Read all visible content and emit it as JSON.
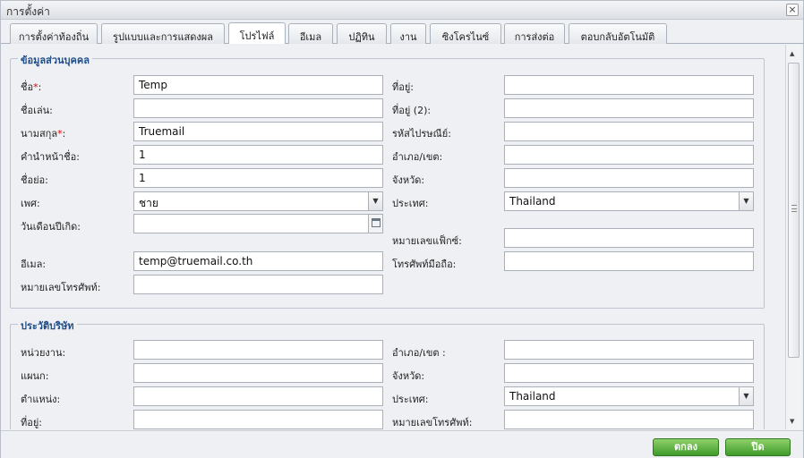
{
  "window": {
    "title": "การตั้งค่า",
    "close_symbol": "×"
  },
  "tabs": [
    {
      "label": "การตั้งค่าท้องถิ่น"
    },
    {
      "label": "รูปแบบและการแสดงผล"
    },
    {
      "label": "โปรไฟล์"
    },
    {
      "label": "อีเมล"
    },
    {
      "label": "ปฏิทิน"
    },
    {
      "label": "งาน"
    },
    {
      "label": "ซิงโครไนซ์"
    },
    {
      "label": "การส่งต่อ"
    },
    {
      "label": "ตอบกลับอัตโนมัติ"
    }
  ],
  "active_tab": "โปรไฟล์",
  "personal": {
    "legend": "ข้อมูลส่วนบุคคล",
    "first_name_label": "ชื่อ",
    "first_name_value": "Temp",
    "nickname_label": "ชื่อเล่น:",
    "nickname_value": "",
    "last_name_label": "นามสกุล",
    "last_name_value": "Truemail",
    "prefix_label": "คำนำหน้าชื่อ:",
    "prefix_value": "1",
    "abbrev_label": "ชื่อย่อ:",
    "abbrev_value": "1",
    "gender_label": "เพศ:",
    "gender_value": "ชาย",
    "birthday_label": "วันเดือนปีเกิด:",
    "birthday_value": "",
    "email_label": "อีเมล:",
    "email_value": "temp@truemail.co.th",
    "phone_label": "หมายเลขโทรศัพท์:",
    "phone_value": "",
    "address_label": "ที่อยู่:",
    "address_value": "",
    "address2_label": "ที่อยู่ (2):",
    "address2_value": "",
    "postal_label": "รหัสไปรษณีย์:",
    "postal_value": "",
    "district_label": "อำเภอ/เขต:",
    "district_value": "",
    "province_label": "จังหวัด:",
    "province_value": "",
    "country_label": "ประเทศ:",
    "country_value": "Thailand",
    "fax_label": "หมายเลขแฟ็กซ์:",
    "fax_value": "",
    "mobile_label": "โทรศัพท์มือถือ:",
    "mobile_value": ""
  },
  "company": {
    "legend": "ประวัติบริษัท",
    "unit_label": "หน่วยงาน:",
    "unit_value": "",
    "dept_label": "แผนก:",
    "dept_value": "",
    "position_label": "ตำแหน่ง:",
    "position_value": "",
    "address_label": "ที่อยู่:",
    "address_value": "",
    "district_label": "อำเภอ/เขต :",
    "district_value": "",
    "province_label": "จังหวัด:",
    "province_value": "",
    "country_label": "ประเทศ:",
    "country_value": "Thailand",
    "phone_label": "หมายเลขโทรศัพท์:",
    "phone_value": ""
  },
  "required_mark": "*",
  "buttons": {
    "ok": "ตกลง",
    "close": "ปิด"
  },
  "icons": {
    "dropdown": "chevron-down-icon",
    "calendar": "calendar-icon",
    "scroll_up": "arrow-up-icon",
    "scroll_down": "arrow-down-icon"
  },
  "colors": {
    "legend": "#1f4e8c",
    "button_green": "#3f9a2a",
    "required": "#dd0000"
  }
}
